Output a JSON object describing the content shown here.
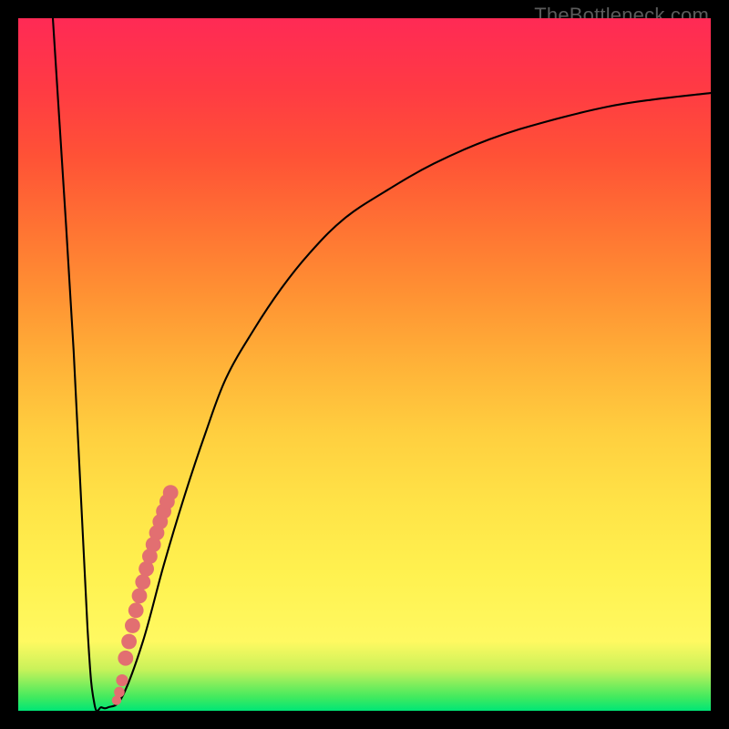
{
  "credit": "TheBottleneck.com",
  "colors": {
    "line": "#000000",
    "dots": "#e26f71",
    "frame": "#000000"
  },
  "chart_data": {
    "type": "line",
    "title": "",
    "xlabel": "",
    "ylabel": "",
    "xlim": [
      0,
      100
    ],
    "ylim": [
      0,
      100
    ],
    "series": [
      {
        "name": "bottleneck_curve",
        "x": [
          5,
          8,
          10,
          11,
          12,
          13,
          15,
          18,
          21,
          24,
          27,
          30,
          34,
          38,
          42,
          47,
          53,
          60,
          68,
          76,
          85,
          92,
          100
        ],
        "y": [
          100,
          52,
          12,
          1,
          0.5,
          0.5,
          2,
          10,
          21,
          31,
          40,
          48,
          55,
          61,
          66,
          71,
          75,
          79,
          82.5,
          85,
          87.2,
          88.3,
          89.2
        ]
      }
    ],
    "points": {
      "name": "highlighted_segment",
      "x": [
        14.2,
        14.6,
        15.0,
        15.5,
        16.0,
        16.5,
        17.0,
        17.5,
        18.0,
        18.5,
        19.0,
        19.5,
        20.0,
        20.5,
        21.0,
        21.5,
        22.0
      ],
      "y": [
        1.5,
        2.7,
        4.4,
        7.6,
        10.0,
        12.3,
        14.5,
        16.6,
        18.6,
        20.5,
        22.3,
        24.0,
        25.7,
        27.3,
        28.8,
        30.2,
        31.5
      ]
    }
  }
}
